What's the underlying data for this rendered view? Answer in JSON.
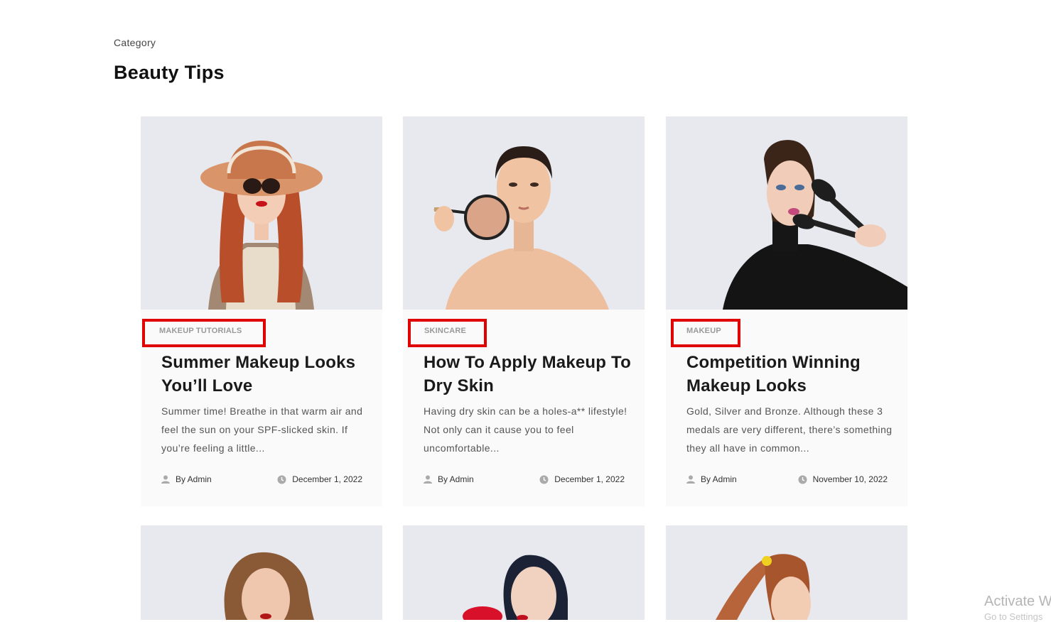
{
  "header": {
    "eyebrow": "Category",
    "title": "Beauty Tips"
  },
  "cards": [
    {
      "tag": "MAKEUP TUTORIALS",
      "title": "Summer Makeup Looks You’ll Love",
      "excerpt": "Summer time! Breathe in that warm air and feel the sun on your SPF-slicked skin. If you’re feeling a little...",
      "author": "By Admin",
      "date": "December 1, 2022",
      "image": "woman-in-sun-hat-photo"
    },
    {
      "tag": "SKINCARE",
      "title": "How To Apply Makeup To Dry Skin",
      "excerpt": "Having dry skin can be a holes-a** lifestyle! Not only can it cause you to feel uncomfortable...",
      "author": "By Admin",
      "date": "December 1, 2022",
      "image": "woman-with-magnifier-photo"
    },
    {
      "tag": "MAKEUP",
      "title": "Competition Winning Makeup Looks",
      "excerpt": "Gold, Silver and Bronze. Although these 3 medals are very different, there’s something they all have in common...",
      "author": "By Admin",
      "date": "November 10, 2022",
      "image": "woman-with-makeup-brushes-photo"
    },
    {
      "image": "woman-with-wavy-hair-photo"
    },
    {
      "image": "woman-with-red-flower-photo"
    },
    {
      "image": "woman-with-ponytail-photo"
    }
  ],
  "watermark": {
    "line1": "Activate W",
    "line2": "Go to Settings"
  },
  "colors": {
    "highlight": "#e00000",
    "image_bg": "#e7e9ee",
    "card_bg": "#fafafa"
  }
}
